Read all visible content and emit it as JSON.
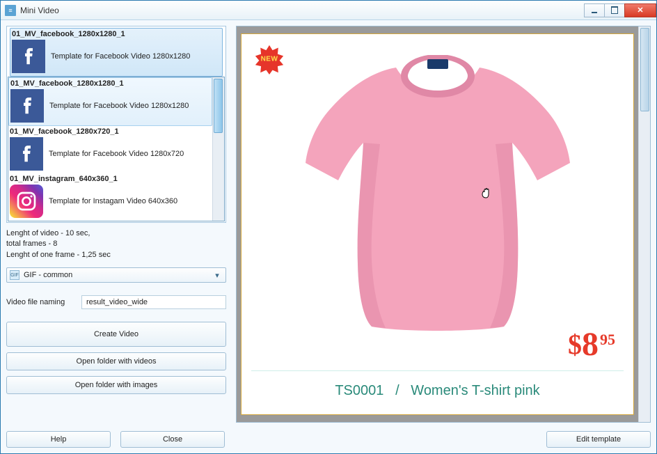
{
  "window": {
    "title": "Mini Video"
  },
  "templates": {
    "selected": {
      "name": "01_MV_facebook_1280x1280_1",
      "desc": "Template for Facebook Video 1280x1280",
      "icon": "facebook"
    },
    "list": [
      {
        "name": "01_MV_facebook_1280x1280_1",
        "desc": "Template for Facebook Video 1280x1280",
        "icon": "facebook"
      },
      {
        "name": "01_MV_facebook_1280x720_1",
        "desc": "Template for Facebook Video 1280x720",
        "icon": "facebook"
      },
      {
        "name": "01_MV_instagram_640x360_1",
        "desc": "Template for Instagam Video 640x360",
        "icon": "instagram"
      }
    ]
  },
  "video_info": {
    "line1": "Lenght of video - 10 sec,",
    "line2": "total frames - 8",
    "line3": "Lenght of one frame  - 1,25 sec"
  },
  "format_combo": {
    "value": "GIF - common"
  },
  "naming": {
    "label": "Video file naming",
    "value": "result_video_wide"
  },
  "buttons": {
    "create": "Create Video",
    "open_videos": "Open folder with videos",
    "open_images": "Open folder with images",
    "help": "Help",
    "close": "Close",
    "edit_template": "Edit template"
  },
  "product": {
    "badge": "NEW",
    "price_currency": "$",
    "price_whole": "8",
    "price_cents": "95",
    "sku": "TS0001",
    "separator": "/",
    "name": "Women's T-shirt pink"
  }
}
